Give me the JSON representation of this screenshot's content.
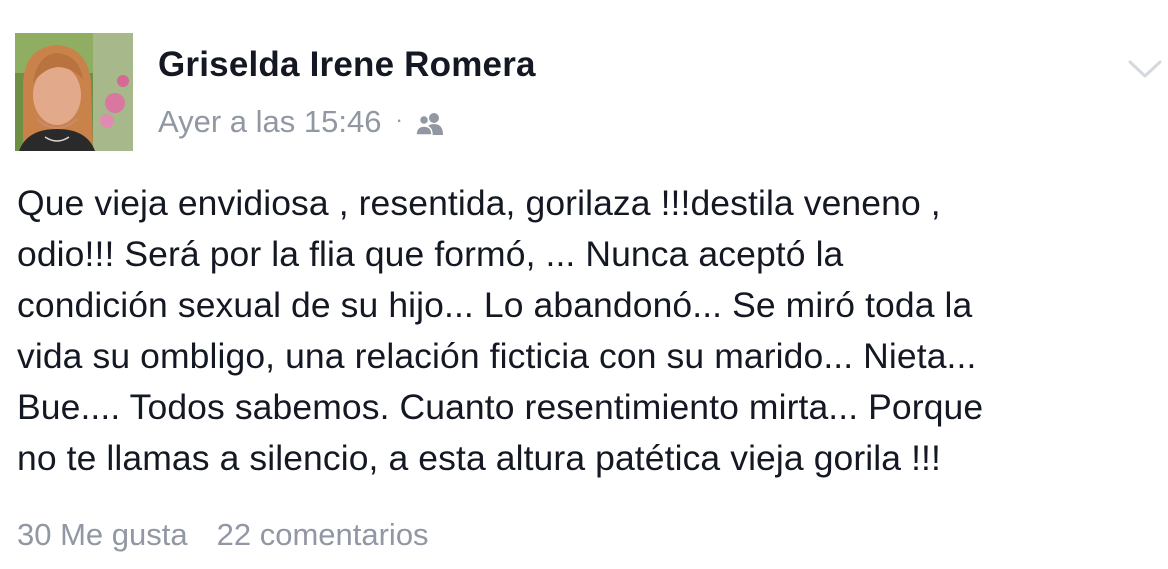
{
  "author": {
    "name": "Griselda Irene Romera",
    "avatar_icon": "profile-photo"
  },
  "meta": {
    "timestamp": "Ayer a las 15:46",
    "separator": "·",
    "audience_icon": "friends-icon"
  },
  "post": {
    "lines": [
      "Que vieja envidiosa , resentida, gorilaza !!!destila veneno ,",
      "odio!!! Será por la flia que formó, ... Nunca aceptó la",
      "condición sexual de su hijo... Lo abandonó... Se miró toda la",
      "vida su ombligo, una relación ficticia con su marido... Nieta...",
      "Bue.... Todos sabemos. Cuanto resentimiento mirta... Porque",
      "no te llamas a silencio, a esta altura patética vieja gorila !!!"
    ]
  },
  "footer": {
    "likes": "30 Me gusta",
    "comments": "22 comentarios"
  },
  "colors": {
    "text": "#141823",
    "secondary": "#9197a3",
    "chevron": "#d5d8de"
  }
}
